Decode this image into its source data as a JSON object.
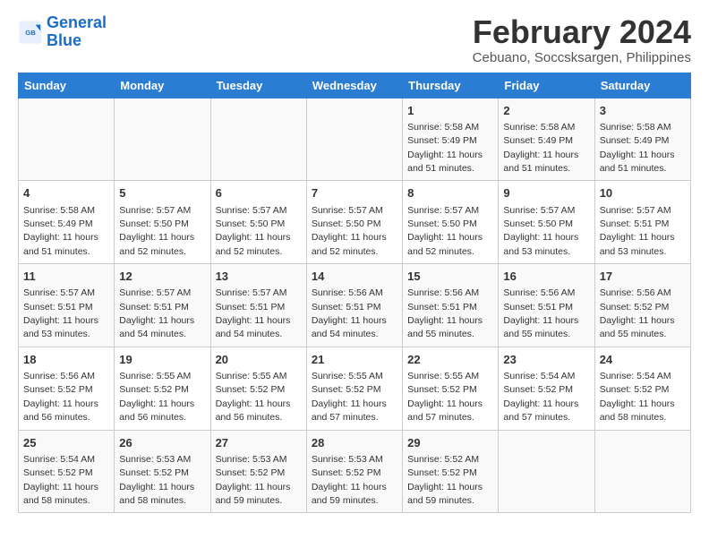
{
  "header": {
    "logo_line1": "General",
    "logo_line2": "Blue",
    "title": "February 2024",
    "subtitle": "Cebuano, Soccsksargen, Philippines"
  },
  "columns": [
    "Sunday",
    "Monday",
    "Tuesday",
    "Wednesday",
    "Thursday",
    "Friday",
    "Saturday"
  ],
  "weeks": [
    [
      {
        "day": "",
        "info": ""
      },
      {
        "day": "",
        "info": ""
      },
      {
        "day": "",
        "info": ""
      },
      {
        "day": "",
        "info": ""
      },
      {
        "day": "1",
        "info": "Sunrise: 5:58 AM\nSunset: 5:49 PM\nDaylight: 11 hours\nand 51 minutes."
      },
      {
        "day": "2",
        "info": "Sunrise: 5:58 AM\nSunset: 5:49 PM\nDaylight: 11 hours\nand 51 minutes."
      },
      {
        "day": "3",
        "info": "Sunrise: 5:58 AM\nSunset: 5:49 PM\nDaylight: 11 hours\nand 51 minutes."
      }
    ],
    [
      {
        "day": "4",
        "info": "Sunrise: 5:58 AM\nSunset: 5:49 PM\nDaylight: 11 hours\nand 51 minutes."
      },
      {
        "day": "5",
        "info": "Sunrise: 5:57 AM\nSunset: 5:50 PM\nDaylight: 11 hours\nand 52 minutes."
      },
      {
        "day": "6",
        "info": "Sunrise: 5:57 AM\nSunset: 5:50 PM\nDaylight: 11 hours\nand 52 minutes."
      },
      {
        "day": "7",
        "info": "Sunrise: 5:57 AM\nSunset: 5:50 PM\nDaylight: 11 hours\nand 52 minutes."
      },
      {
        "day": "8",
        "info": "Sunrise: 5:57 AM\nSunset: 5:50 PM\nDaylight: 11 hours\nand 52 minutes."
      },
      {
        "day": "9",
        "info": "Sunrise: 5:57 AM\nSunset: 5:50 PM\nDaylight: 11 hours\nand 53 minutes."
      },
      {
        "day": "10",
        "info": "Sunrise: 5:57 AM\nSunset: 5:51 PM\nDaylight: 11 hours\nand 53 minutes."
      }
    ],
    [
      {
        "day": "11",
        "info": "Sunrise: 5:57 AM\nSunset: 5:51 PM\nDaylight: 11 hours\nand 53 minutes."
      },
      {
        "day": "12",
        "info": "Sunrise: 5:57 AM\nSunset: 5:51 PM\nDaylight: 11 hours\nand 54 minutes."
      },
      {
        "day": "13",
        "info": "Sunrise: 5:57 AM\nSunset: 5:51 PM\nDaylight: 11 hours\nand 54 minutes."
      },
      {
        "day": "14",
        "info": "Sunrise: 5:56 AM\nSunset: 5:51 PM\nDaylight: 11 hours\nand 54 minutes."
      },
      {
        "day": "15",
        "info": "Sunrise: 5:56 AM\nSunset: 5:51 PM\nDaylight: 11 hours\nand 55 minutes."
      },
      {
        "day": "16",
        "info": "Sunrise: 5:56 AM\nSunset: 5:51 PM\nDaylight: 11 hours\nand 55 minutes."
      },
      {
        "day": "17",
        "info": "Sunrise: 5:56 AM\nSunset: 5:52 PM\nDaylight: 11 hours\nand 55 minutes."
      }
    ],
    [
      {
        "day": "18",
        "info": "Sunrise: 5:56 AM\nSunset: 5:52 PM\nDaylight: 11 hours\nand 56 minutes."
      },
      {
        "day": "19",
        "info": "Sunrise: 5:55 AM\nSunset: 5:52 PM\nDaylight: 11 hours\nand 56 minutes."
      },
      {
        "day": "20",
        "info": "Sunrise: 5:55 AM\nSunset: 5:52 PM\nDaylight: 11 hours\nand 56 minutes."
      },
      {
        "day": "21",
        "info": "Sunrise: 5:55 AM\nSunset: 5:52 PM\nDaylight: 11 hours\nand 57 minutes."
      },
      {
        "day": "22",
        "info": "Sunrise: 5:55 AM\nSunset: 5:52 PM\nDaylight: 11 hours\nand 57 minutes."
      },
      {
        "day": "23",
        "info": "Sunrise: 5:54 AM\nSunset: 5:52 PM\nDaylight: 11 hours\nand 57 minutes."
      },
      {
        "day": "24",
        "info": "Sunrise: 5:54 AM\nSunset: 5:52 PM\nDaylight: 11 hours\nand 58 minutes."
      }
    ],
    [
      {
        "day": "25",
        "info": "Sunrise: 5:54 AM\nSunset: 5:52 PM\nDaylight: 11 hours\nand 58 minutes."
      },
      {
        "day": "26",
        "info": "Sunrise: 5:53 AM\nSunset: 5:52 PM\nDaylight: 11 hours\nand 58 minutes."
      },
      {
        "day": "27",
        "info": "Sunrise: 5:53 AM\nSunset: 5:52 PM\nDaylight: 11 hours\nand 59 minutes."
      },
      {
        "day": "28",
        "info": "Sunrise: 5:53 AM\nSunset: 5:52 PM\nDaylight: 11 hours\nand 59 minutes."
      },
      {
        "day": "29",
        "info": "Sunrise: 5:52 AM\nSunset: 5:52 PM\nDaylight: 11 hours\nand 59 minutes."
      },
      {
        "day": "",
        "info": ""
      },
      {
        "day": "",
        "info": ""
      }
    ]
  ]
}
